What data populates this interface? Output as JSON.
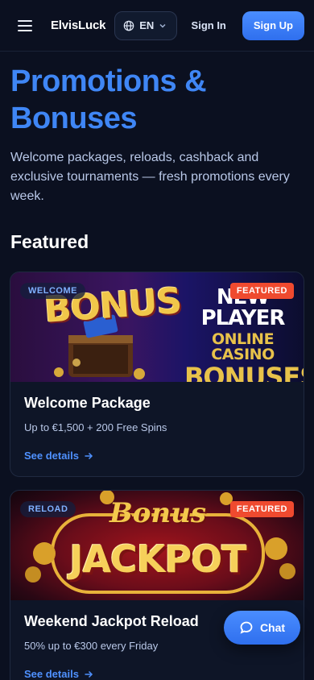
{
  "header": {
    "logo": "ElvisLuck",
    "language": "EN",
    "sign_in": "Sign In",
    "sign_up": "Sign Up"
  },
  "hero": {
    "title": "Promotions & Bonuses",
    "subtitle": "Welcome packages, reloads, cashback and exclusive tournaments — fresh promotions every week."
  },
  "featured": {
    "heading": "Featured",
    "cards": [
      {
        "category": "WELCOME",
        "badge": "FEATURED",
        "title": "Welcome Package",
        "offer": "Up to €1,500 + 200 Free Spins",
        "link": "See details",
        "art_left": "BONUS",
        "art_right": [
          "NEW PLAYER",
          "ONLINE CASINO",
          "BONUSES"
        ]
      },
      {
        "category": "RELOAD",
        "badge": "FEATURED",
        "title": "Weekend Jackpot Reload",
        "offer": "50% up to €300 every Friday",
        "link": "See details",
        "art_top": "Bonus",
        "art_main": "JACKPOT"
      }
    ]
  },
  "chat": {
    "label": "Chat"
  },
  "colors": {
    "accent": "#3f86f5",
    "badge": "#ef4a2f",
    "background": "#0b1020"
  }
}
